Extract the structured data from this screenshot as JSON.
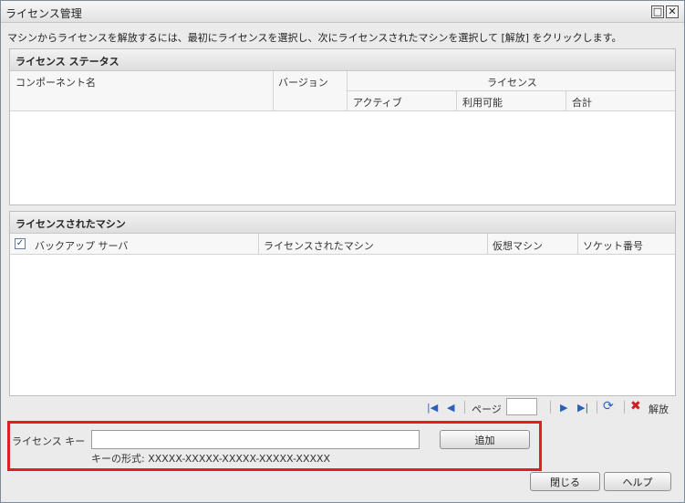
{
  "window": {
    "title": "ライセンス管理",
    "restore_glyph": "□",
    "close_glyph": "✕"
  },
  "instructions": "マシンからライセンスを解放するには、最初にライセンスを選択し、次にライセンスされたマシンを選択して [解放] をクリックします。",
  "license_status": {
    "heading": "ライセンス ステータス",
    "columns": {
      "component": "コンポーネント名",
      "version": "バージョン",
      "license": "ライセンス",
      "active": "アクティブ",
      "available": "利用可能",
      "total": "合計"
    }
  },
  "licensed_machines": {
    "heading": "ライセンスされたマシン",
    "columns": {
      "backup_server": "バックアップ サーバ",
      "licensed_machine": "ライセンスされたマシン",
      "virtual_machine": "仮想マシン",
      "socket_count": "ソケット番号"
    }
  },
  "pager": {
    "page_label": "ページ",
    "page_value": "",
    "release_label": "解放"
  },
  "license_key": {
    "label": "ライセンス キー",
    "value": "",
    "add_label": "追加",
    "format_hint": "キーの形式: XXXXX-XXXXX-XXXXX-XXXXX-XXXXX"
  },
  "footer": {
    "close_label": "閉じる",
    "help_label": "ヘルプ"
  },
  "colors": {
    "highlight": "#e02020",
    "pager_icon": "#2a62b8",
    "release_icon": "#cc1f1f"
  }
}
